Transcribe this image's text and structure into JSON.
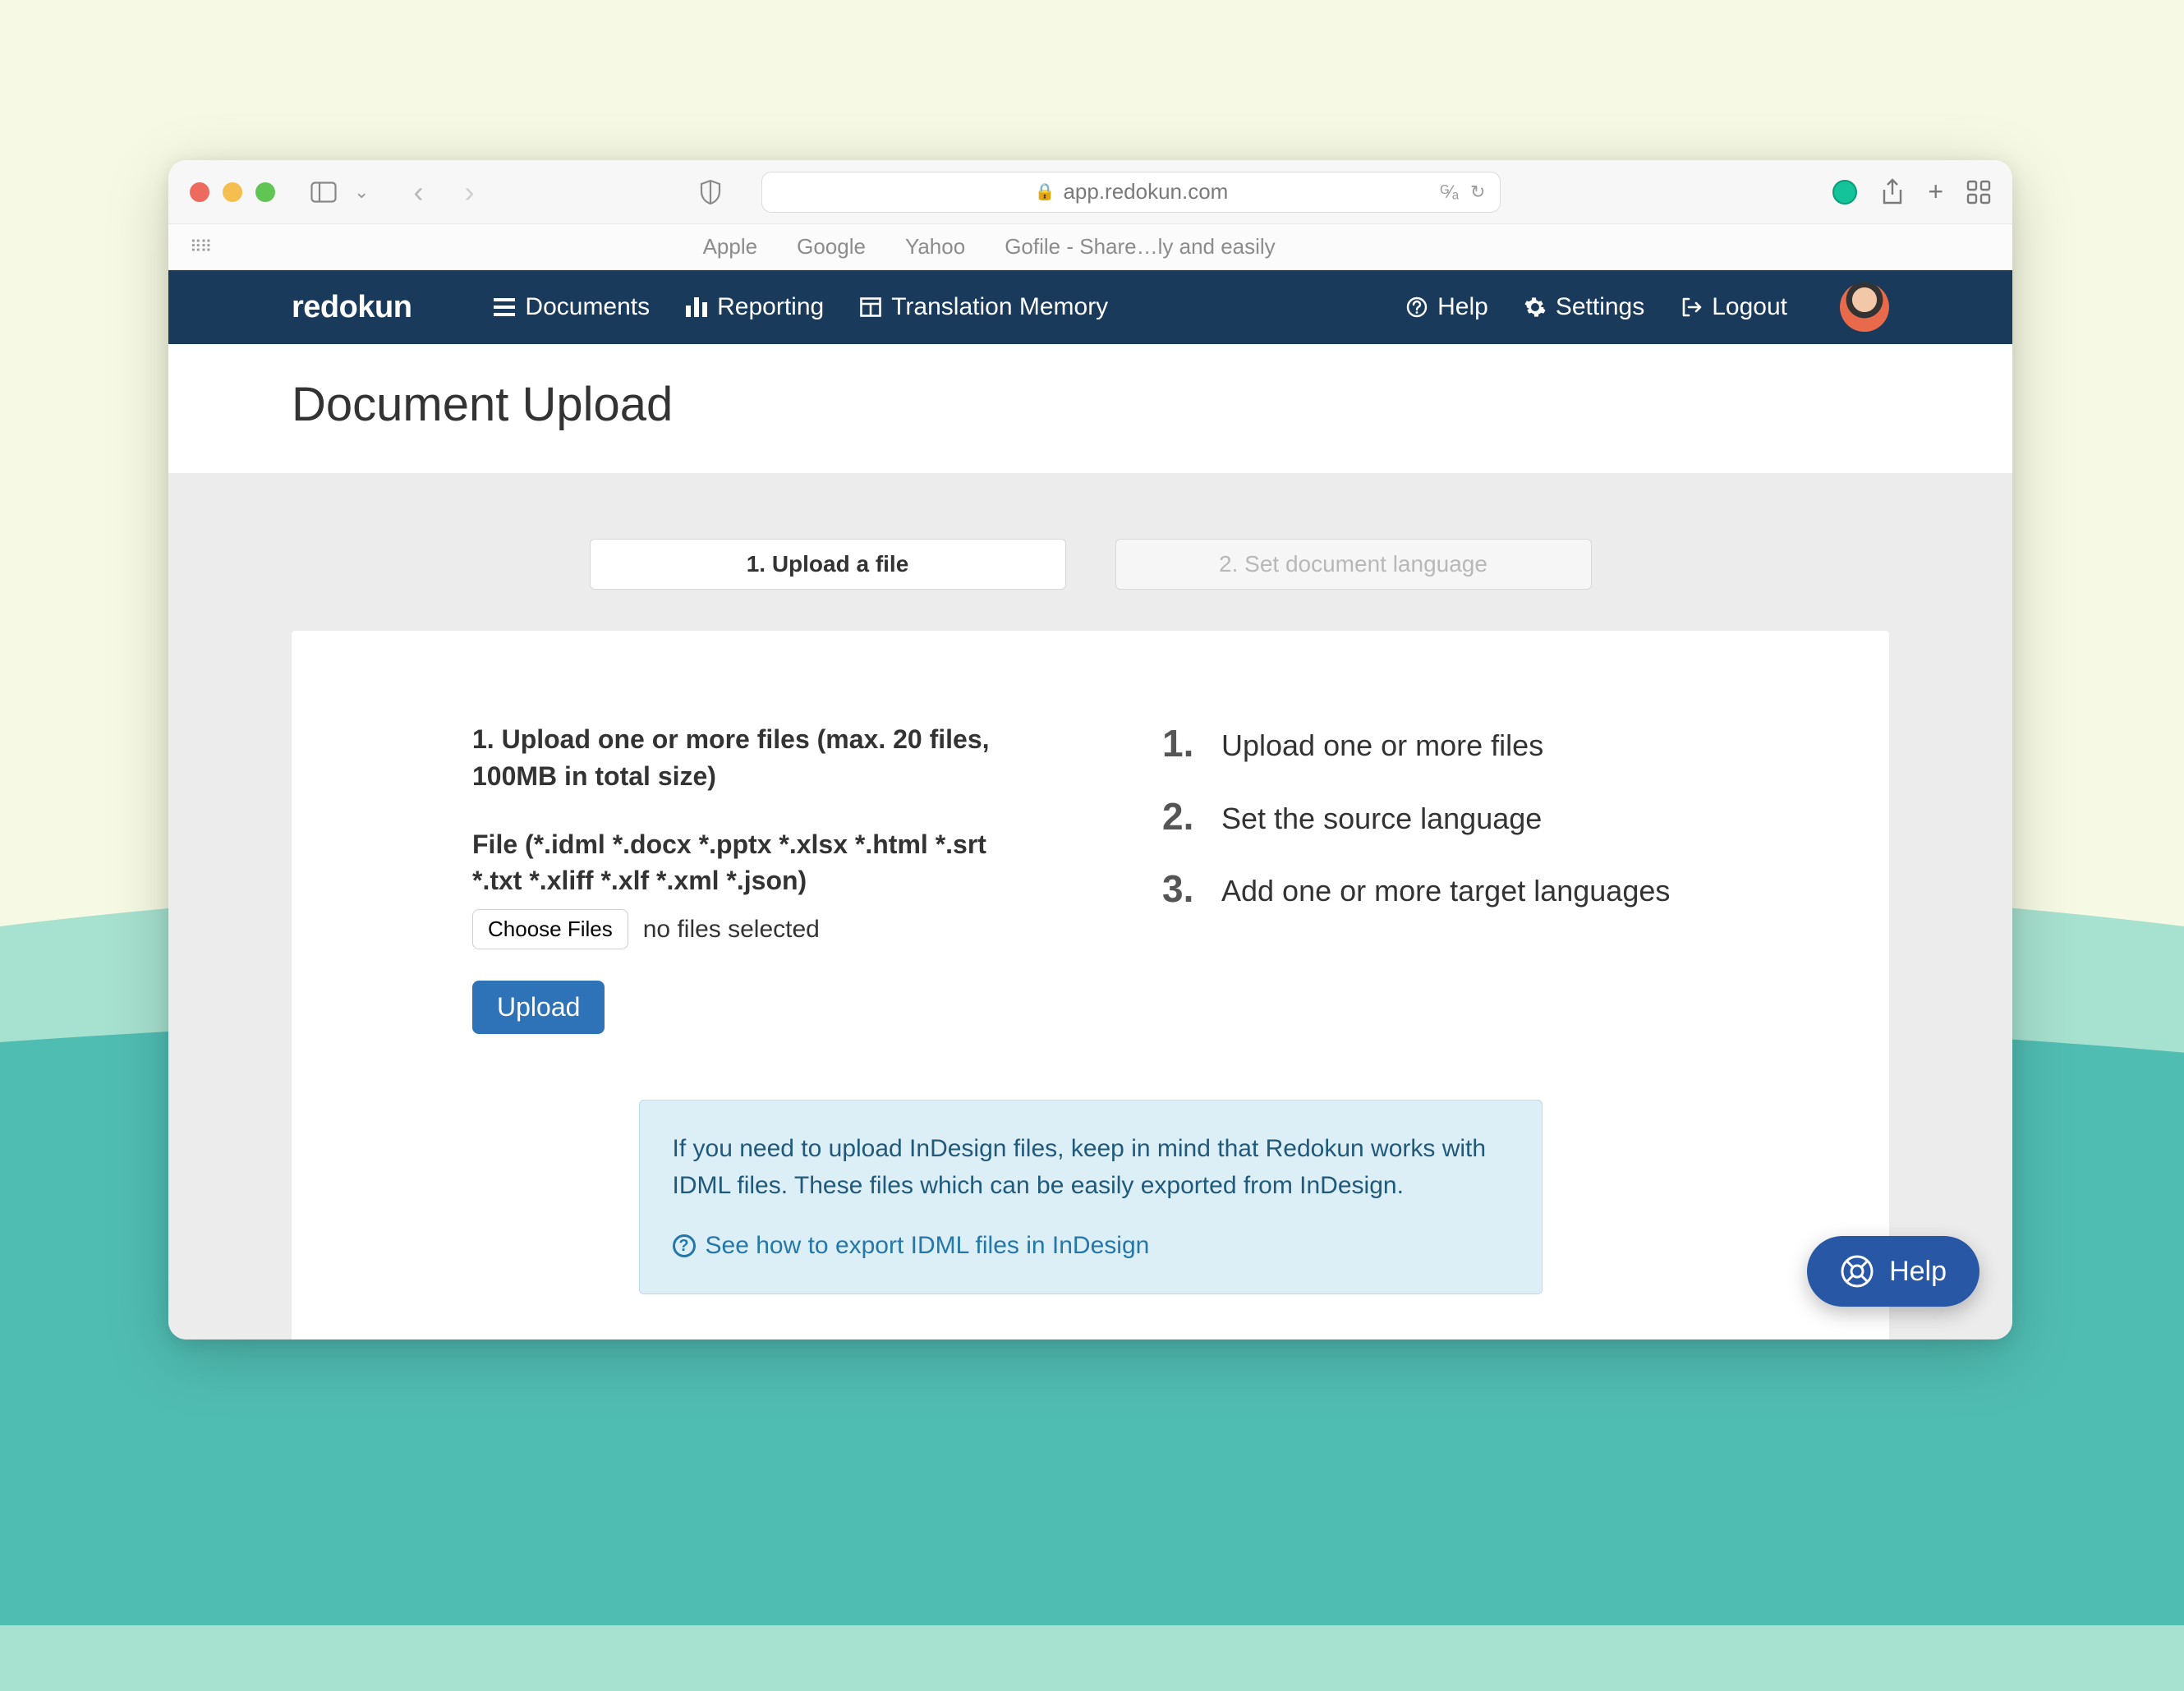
{
  "browser": {
    "url_host": "app.redokun.com",
    "bookmarks": [
      "Apple",
      "Google",
      "Yahoo",
      "Gofile - Share…ly and easily"
    ]
  },
  "nav": {
    "brand": "redokun",
    "items": [
      {
        "label": "Documents"
      },
      {
        "label": "Reporting"
      },
      {
        "label": "Translation Memory"
      }
    ],
    "right": [
      {
        "label": "Help"
      },
      {
        "label": "Settings"
      },
      {
        "label": "Logout"
      }
    ]
  },
  "page": {
    "title": "Document Upload"
  },
  "tabs": {
    "active": "1. Upload a file",
    "inactive": "2. Set document language"
  },
  "upload": {
    "heading": "1. Upload one or more files (max. 20 files, 100MB in total size)",
    "file_types": "File (*.idml *.docx *.pptx *.xlsx *.html *.srt *.txt *.xliff *.xlf *.xml *.json)",
    "choose_label": "Choose Files",
    "no_files": "no files selected",
    "button": "Upload"
  },
  "steps": [
    {
      "num": "1.",
      "text": "Upload one or more files"
    },
    {
      "num": "2.",
      "text": "Set the source language"
    },
    {
      "num": "3.",
      "text": "Add one or more target languages"
    }
  ],
  "info": {
    "text": "If you need to upload InDesign files, keep in mind that Redokun works with IDML files. These files which can be easily exported from InDesign.",
    "link": "See how to export IDML files in InDesign"
  },
  "fab": {
    "label": "Help"
  }
}
